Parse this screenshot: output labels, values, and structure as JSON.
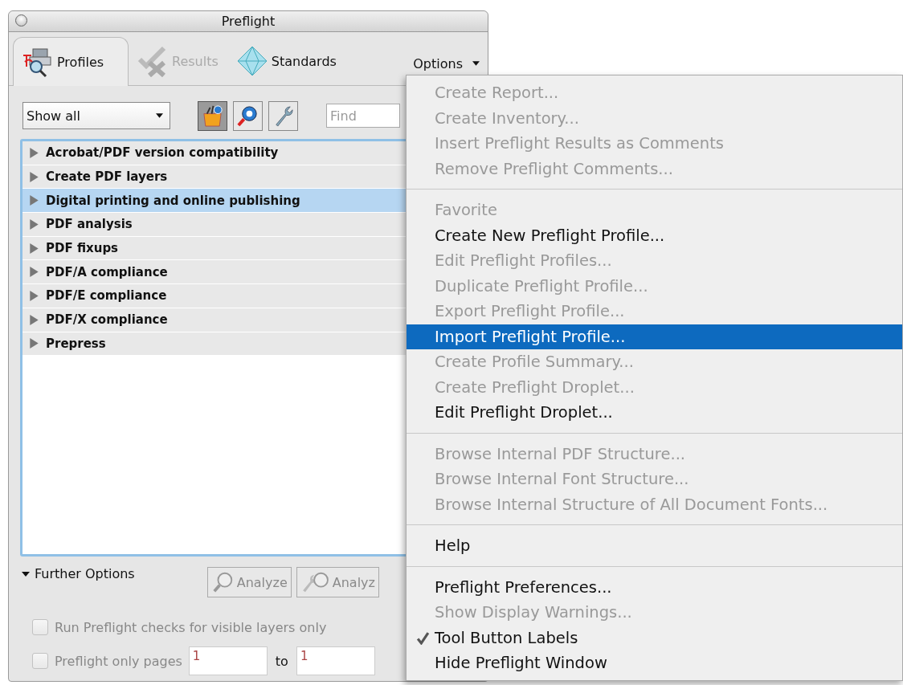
{
  "window": {
    "title": "Preflight"
  },
  "tabs": [
    {
      "label": "Profiles",
      "selected": true,
      "disabled": false,
      "kind": "profiles"
    },
    {
      "label": "Results",
      "selected": false,
      "disabled": true,
      "kind": "results"
    },
    {
      "label": "Standards",
      "selected": false,
      "disabled": false,
      "kind": "standards"
    }
  ],
  "options_menu": {
    "label": "Options",
    "expanded": true
  },
  "filter": {
    "value": "Show all"
  },
  "tool_buttons": [
    {
      "kind": "box",
      "selected": true
    },
    {
      "kind": "magnifier",
      "selected": false
    },
    {
      "kind": "wrench",
      "selected": false
    }
  ],
  "search": {
    "placeholder": "Find"
  },
  "profile_groups": [
    {
      "label": "Acrobat/PDF version compatibility",
      "selected": false,
      "expanded": false
    },
    {
      "label": "Create PDF layers",
      "selected": false,
      "expanded": false
    },
    {
      "label": "Digital printing and online publishing",
      "selected": true,
      "expanded": false
    },
    {
      "label": "PDF analysis",
      "selected": false,
      "expanded": false
    },
    {
      "label": "PDF fixups",
      "selected": false,
      "expanded": false
    },
    {
      "label": "PDF/A compliance",
      "selected": false,
      "expanded": false
    },
    {
      "label": "PDF/E compliance",
      "selected": false,
      "expanded": false
    },
    {
      "label": "PDF/X compliance",
      "selected": false,
      "expanded": false
    },
    {
      "label": "Prepress",
      "selected": false,
      "expanded": false
    }
  ],
  "further_options": {
    "label": "Further Options",
    "expanded": true
  },
  "analyze_buttons": [
    {
      "label": "Analyze",
      "disabled": true,
      "kind": "analyze"
    },
    {
      "label": "Analyz",
      "disabled": true,
      "kind": "fix"
    }
  ],
  "checkboxes": [
    {
      "label": "Run Preflight checks for visible layers only",
      "checked": false,
      "disabled": true
    },
    {
      "label": "Preflight only pages",
      "checked": false,
      "disabled": true
    }
  ],
  "page_range": {
    "from": "1",
    "separator": "to",
    "to": "1"
  },
  "menu": [
    {
      "kind": "item",
      "label": "Create Report...",
      "disabled": true,
      "selected": false,
      "checked": false
    },
    {
      "kind": "item",
      "label": "Create Inventory...",
      "disabled": true,
      "selected": false,
      "checked": false
    },
    {
      "kind": "item",
      "label": "Insert Preflight Results as Comments",
      "disabled": true,
      "selected": false,
      "checked": false
    },
    {
      "kind": "item",
      "label": "Remove Preflight Comments...",
      "disabled": true,
      "selected": false,
      "checked": false
    },
    {
      "kind": "separator"
    },
    {
      "kind": "item",
      "label": "Favorite",
      "disabled": true,
      "selected": false,
      "checked": false
    },
    {
      "kind": "item",
      "label": "Create New Preflight Profile...",
      "disabled": false,
      "selected": false,
      "checked": false
    },
    {
      "kind": "item",
      "label": "Edit Preflight Profiles...",
      "disabled": true,
      "selected": false,
      "checked": false
    },
    {
      "kind": "item",
      "label": "Duplicate Preflight Profile...",
      "disabled": true,
      "selected": false,
      "checked": false
    },
    {
      "kind": "item",
      "label": "Export Preflight Profile...",
      "disabled": true,
      "selected": false,
      "checked": false
    },
    {
      "kind": "item",
      "label": "Import Preflight Profile...",
      "disabled": false,
      "selected": true,
      "checked": false
    },
    {
      "kind": "item",
      "label": "Create Profile Summary...",
      "disabled": true,
      "selected": false,
      "checked": false
    },
    {
      "kind": "item",
      "label": "Create Preflight Droplet...",
      "disabled": true,
      "selected": false,
      "checked": false
    },
    {
      "kind": "item",
      "label": "Edit Preflight Droplet...",
      "disabled": false,
      "selected": false,
      "checked": false
    },
    {
      "kind": "separator"
    },
    {
      "kind": "item",
      "label": "Browse Internal PDF Structure...",
      "disabled": true,
      "selected": false,
      "checked": false
    },
    {
      "kind": "item",
      "label": "Browse Internal Font Structure...",
      "disabled": true,
      "selected": false,
      "checked": false
    },
    {
      "kind": "item",
      "label": "Browse Internal Structure of All Document Fonts...",
      "disabled": true,
      "selected": false,
      "checked": false
    },
    {
      "kind": "separator"
    },
    {
      "kind": "item",
      "label": "Help",
      "disabled": false,
      "selected": false,
      "checked": false
    },
    {
      "kind": "separator"
    },
    {
      "kind": "item",
      "label": "Preflight Preferences...",
      "disabled": false,
      "selected": false,
      "checked": false
    },
    {
      "kind": "item",
      "label": "Show Display Warnings...",
      "disabled": true,
      "selected": false,
      "checked": false
    },
    {
      "kind": "item",
      "label": "Tool Button Labels",
      "disabled": false,
      "selected": false,
      "checked": true
    },
    {
      "kind": "item",
      "label": "Hide Preflight Window",
      "disabled": false,
      "selected": false,
      "checked": false
    }
  ]
}
